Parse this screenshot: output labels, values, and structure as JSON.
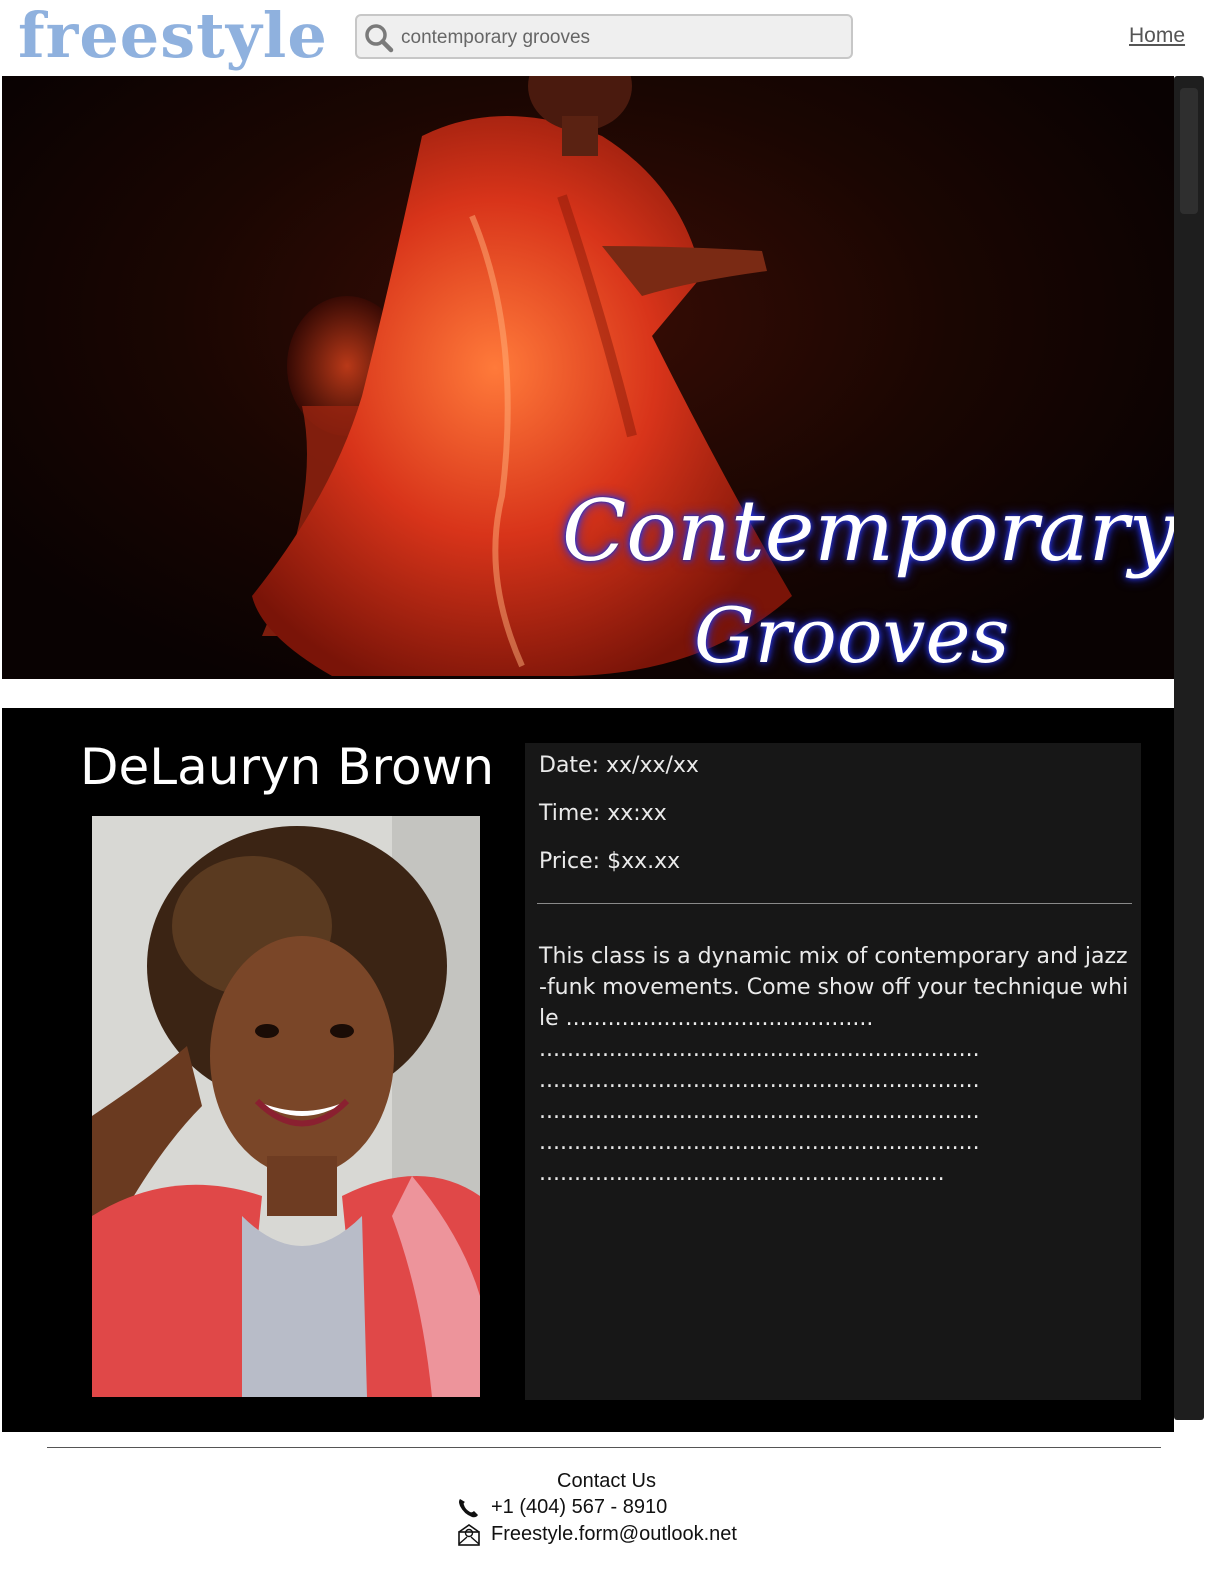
{
  "header": {
    "logo_text": "freestyle",
    "search": {
      "value": "contemporary grooves",
      "placeholder": ""
    },
    "nav": {
      "home_label": "Home"
    }
  },
  "hero": {
    "title_line1": "Contemporary",
    "title_line2": "Grooves"
  },
  "class_info": {
    "instructor_name": "DeLauryn Brown",
    "date": "Date: xx/xx/xx",
    "time": "Time: xx:xx",
    "price": "Price: $xx.xx",
    "description": "This class is a dynamic mix of contemporary and jazz-funk movements. Come show off your technique while ............................................ ............................................................... ............................................................... ............................................................... ............................................................... .........................................................."
  },
  "footer": {
    "contact_title": "Contact Us",
    "phone": "+1 (404) 567 - 8910",
    "email": "Freestyle.form@outlook.net"
  },
  "colors": {
    "logo": "#8fb1de",
    "hero_background": "#1a0602",
    "content_background": "#000000",
    "panel_background": "#171717",
    "hero_title_glow": "#1c2bd9"
  },
  "icons": [
    "search-icon",
    "phone-icon",
    "email-icon"
  ]
}
